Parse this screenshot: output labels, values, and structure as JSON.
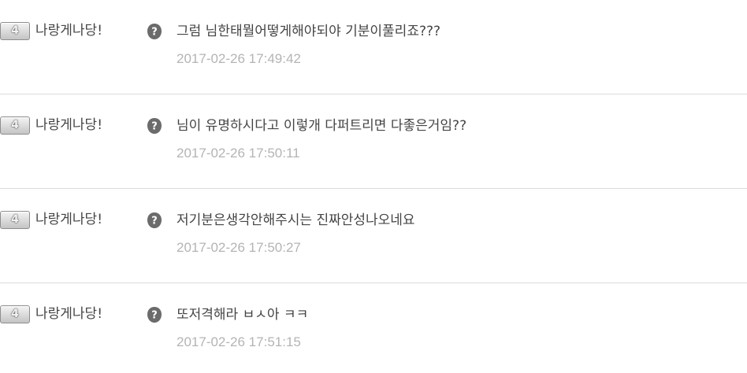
{
  "comments": [
    {
      "level": "4",
      "nickname": "나랑게나당!",
      "text": "그럼 님한태뭘어떻게해야되야 기분이풀리죠???",
      "time": "2017-02-26 17:49:42",
      "icon": "question-icon"
    },
    {
      "level": "4",
      "nickname": "나랑게나당!",
      "text": "님이 유명하시다고 이렇개 다퍼트리면 다좋은거임??",
      "time": "2017-02-26 17:50:11",
      "icon": "question-icon"
    },
    {
      "level": "4",
      "nickname": "나랑게나당!",
      "text": "저기분은생각안해주시는 진짜안성나오네요",
      "time": "2017-02-26 17:50:27",
      "icon": "question-icon"
    },
    {
      "level": "4",
      "nickname": "나랑게나당!",
      "text": "또저격해라 ㅂㅅ아 ㅋㅋ",
      "time": "2017-02-26 17:51:15",
      "icon": "question-icon"
    }
  ],
  "colors": {
    "text": "#444444",
    "timestamp": "#b4b4b4",
    "divider": "#dcdcdc",
    "icon": "#6b6b6b"
  }
}
